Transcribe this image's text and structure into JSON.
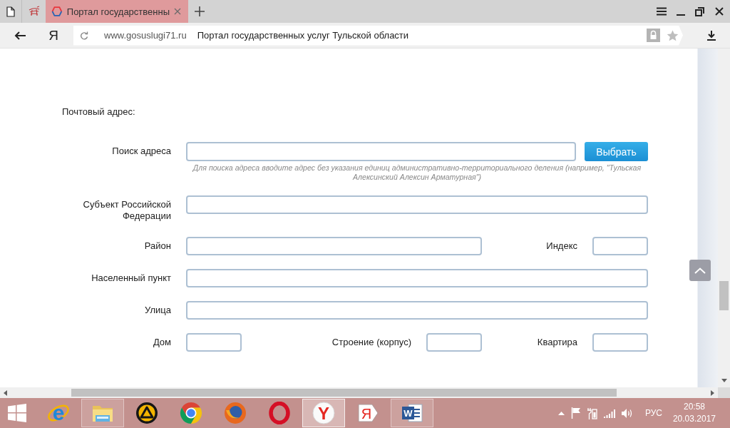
{
  "browser": {
    "tabs": [
      {
        "kind": "pinned",
        "selected": false
      },
      {
        "kind": "page",
        "title": "Портал государственны",
        "selected": true
      }
    ],
    "home_button": "Я",
    "address_bar": {
      "url": "www.gosuslugi71.ru",
      "page_title": "Портал государственных услуг Тульской области"
    }
  },
  "form": {
    "heading": "Почтовый адрес:",
    "search": {
      "label": "Поиск адреса",
      "button": "Выбрать",
      "hint": "Для поиска адреса вводите адрес без указания единиц административно-территориального деления (например, \"Тульская Алексинский Алексин Арматурная\")"
    },
    "rows": [
      {
        "fields": [
          {
            "label": "Субъект Российской Федерации",
            "kind": "full"
          }
        ]
      },
      {
        "fields": [
          {
            "label": "Район",
            "kind": "medium"
          },
          {
            "label": "Индекс",
            "kind": "short"
          }
        ]
      },
      {
        "fields": [
          {
            "label": "Населенный пункт",
            "kind": "full"
          }
        ]
      },
      {
        "fields": [
          {
            "label": "Улица",
            "kind": "full"
          }
        ]
      },
      {
        "fields": [
          {
            "label": "Дом",
            "kind": "short"
          },
          {
            "label": "Строение (корпус)",
            "kind": "short"
          },
          {
            "label": "Квартира",
            "kind": "short"
          }
        ]
      }
    ]
  },
  "taskbar": {
    "apps": [
      {
        "kind": "ie",
        "glyph": "e",
        "open": false,
        "selected": false
      },
      {
        "kind": "explorer",
        "open": true,
        "selected": false
      },
      {
        "kind": "aimp",
        "open": false,
        "selected": false
      },
      {
        "kind": "chrome",
        "open": false,
        "selected": false
      },
      {
        "kind": "firefox",
        "open": false,
        "selected": false
      },
      {
        "kind": "opera",
        "open": false,
        "selected": false
      },
      {
        "kind": "yandex-browser",
        "glyph": "Y",
        "open": true,
        "selected": true
      },
      {
        "kind": "yandex",
        "glyph": "Я",
        "open": false,
        "selected": false
      },
      {
        "kind": "word",
        "glyph": "W",
        "open": true,
        "selected": false
      }
    ],
    "tray": {
      "language": "РУС",
      "time": "20:58",
      "date": "20.03.2017"
    }
  }
}
